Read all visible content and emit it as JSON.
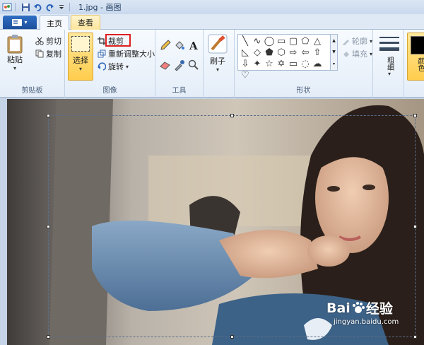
{
  "titlebar": {
    "title": "1.jpg - 画图"
  },
  "tabs": {
    "file_icon": "menu-icon",
    "home": "主页",
    "view": "查看"
  },
  "clipboard": {
    "paste": "粘贴",
    "cut": "剪切",
    "copy": "复制",
    "group": "剪贴板"
  },
  "image": {
    "select": "选择",
    "crop": "裁剪",
    "resize": "重新调整大小",
    "rotate": "旋转",
    "group": "图像"
  },
  "tools": {
    "group": "工具"
  },
  "brush": {
    "label": "刷子"
  },
  "shapes": {
    "outline": "轮廓",
    "fill": "填充",
    "group": "形状"
  },
  "size": {
    "label": "粗细"
  },
  "colors": {
    "label": "颜色",
    "color1": "#000000"
  },
  "watermark": {
    "brand": "Bai",
    "brand2": "经验",
    "url": "jingyan.baidu.com"
  },
  "accent": {
    "highlight": "#e02020",
    "selected": "#ffd45c"
  }
}
